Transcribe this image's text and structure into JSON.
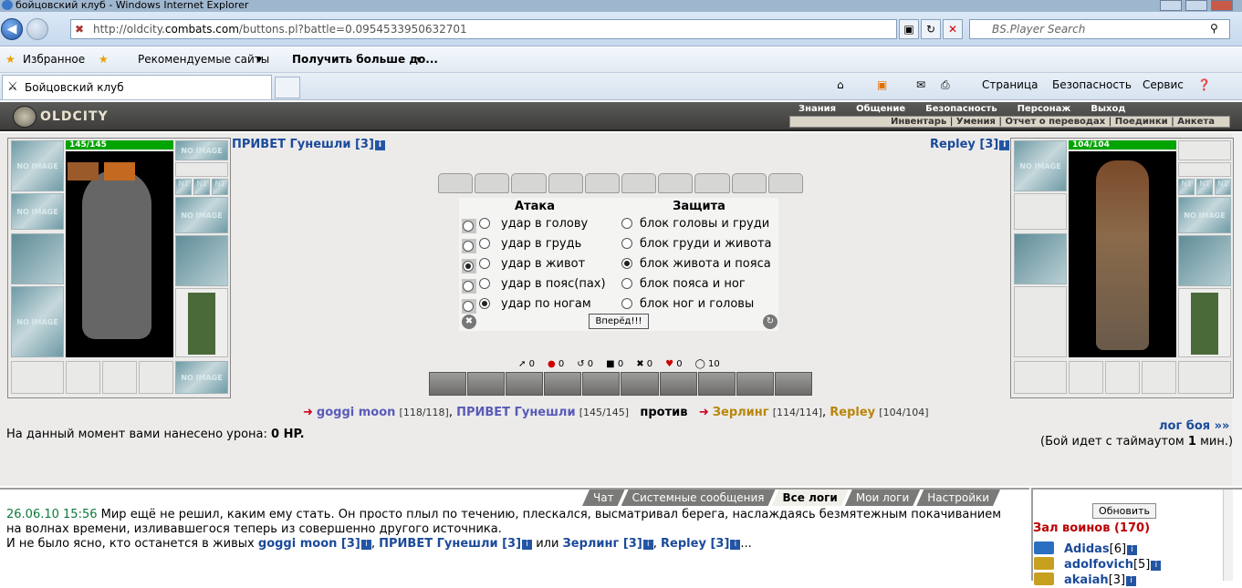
{
  "window": {
    "title": "бойцовский клуб - Windows Internet Explorer"
  },
  "address": {
    "url_prefix": "http://oldcity.",
    "url_domain": "combats.com",
    "url_rest": "/buttons.pl?battle=0.0954533950632701",
    "search_placeholder": "BS.Player Search"
  },
  "favorites": {
    "fav_label": "Избранное",
    "suggested_label": "Рекомендуемые сайты",
    "more_label": "Получить больше до..."
  },
  "tabs": {
    "active_label": "Бойцовский клуб"
  },
  "commands": {
    "page": "Страница",
    "safety": "Безопасность",
    "service": "Сервис"
  },
  "game_header": {
    "logo": "OLDCITY",
    "menu": [
      "Знания",
      "Общение",
      "Безопасность",
      "Персонаж",
      "Выход"
    ],
    "submenu": "Инвентарь | Умения | Отчет о переводах | Поединки | Анкета"
  },
  "left_player": {
    "name": "ПРИВЕТ Гунешли [3]",
    "hp": "145/145",
    "hp_fraction": 1.0,
    "slot_text": "NO IMAGE",
    "small_slot": "N1"
  },
  "right_player": {
    "name": "Repley [3]",
    "hp": "104/104",
    "hp_fraction": 1.0,
    "slot_text": "NO IMAGE",
    "small_slot": "N1"
  },
  "combat": {
    "attack_header": "Атака",
    "defense_header": "Защита",
    "attacks": [
      {
        "label": "удар в голову",
        "selected": false,
        "box_selected": false
      },
      {
        "label": "удар в грудь",
        "selected": false,
        "box_selected": false
      },
      {
        "label": "удар в живот",
        "selected": false,
        "box_selected": true
      },
      {
        "label": "удар в пояс(пах)",
        "selected": false,
        "box_selected": false
      },
      {
        "label": "удар по ногам",
        "selected": true,
        "box_selected": false
      }
    ],
    "defenses": [
      {
        "label": "блок головы и груди",
        "selected": false
      },
      {
        "label": "блок груди и живота",
        "selected": false
      },
      {
        "label": "блок живота и пояса",
        "selected": true
      },
      {
        "label": "блок пояса и ног",
        "selected": false
      },
      {
        "label": "блок ног и головы",
        "selected": false
      }
    ],
    "go_button": "Вперёд!!!"
  },
  "stats": [
    "0",
    "0",
    "0",
    "0",
    "0",
    "0",
    "10"
  ],
  "battle_line": {
    "team1_a": "goggi moon",
    "team1_a_hp": "[118/118]",
    "team1_b": "ПРИВЕТ Гунешли",
    "team1_b_hp": "[145/145]",
    "vs": "против",
    "team2_a": "Зерлинг",
    "team2_a_hp": "[114/114]",
    "team2_b": "Repley",
    "team2_b_hp": "[104/104]"
  },
  "damage": {
    "prefix": "На данный момент вами нанесено урона:",
    "value": "0 HP."
  },
  "log_link": "лог боя »»",
  "timeout": {
    "prefix": "(Бой идет с таймаутом",
    "value": "1",
    "suffix": "мин.)"
  },
  "chat_tabs": [
    "Чат",
    "Системные сообщения",
    "Все логи",
    "Мои логи",
    "Настройки"
  ],
  "chat_active_tab": "Все логи",
  "chat": {
    "timestamp": "26.06.10 15:56",
    "line1": "Мир ещё не решил, каким ему стать. Он просто плыл по течению, плескался, высматривал берега, наслаждаясь безмятежным покачиванием на волнах времени, изливавшегося теперь из совершенно другого источника.",
    "line2_prefix": "И не было ясно, кто останется в живых",
    "n1": "goggi moon [3]",
    "sep1": ",",
    "n2": "ПРИВЕТ Гунешли [3]",
    "sep2": "или",
    "n3": "Зерлинг [3]",
    "sep3": ",",
    "n4": "Repley [3]",
    "ellipsis": "..."
  },
  "room": {
    "refresh": "Обновить",
    "title": "Зал воинов (170)",
    "users": [
      {
        "name": "Adidas",
        "level": "[6]"
      },
      {
        "name": "adolfovich",
        "level": "[5]"
      },
      {
        "name": "akaiah",
        "level": "[3]"
      }
    ]
  },
  "colors": {
    "hp": "#00a400",
    "link": "#1b4a9a",
    "timestamp": "#0a7a3a",
    "room_title": "#bb0000"
  }
}
